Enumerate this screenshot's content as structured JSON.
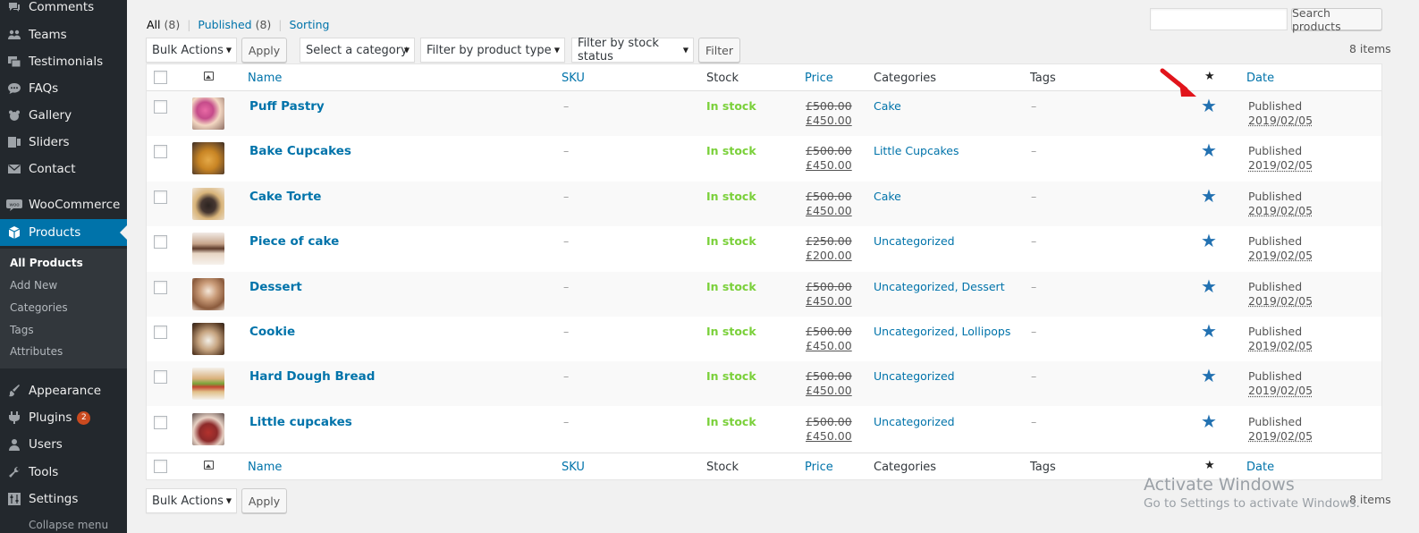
{
  "sidebar": {
    "items": [
      {
        "label": "Comments",
        "icon": "comments-icon"
      },
      {
        "label": "Teams",
        "icon": "teams-icon"
      },
      {
        "label": "Testimonials",
        "icon": "testimonials-icon"
      },
      {
        "label": "FAQs",
        "icon": "faq-icon"
      },
      {
        "label": "Gallery",
        "icon": "gallery-icon"
      },
      {
        "label": "Sliders",
        "icon": "sliders-icon"
      },
      {
        "label": "Contact",
        "icon": "mail-icon"
      },
      {
        "label": "WooCommerce",
        "icon": "woocommerce-icon"
      },
      {
        "label": "Products",
        "icon": "products-icon"
      },
      {
        "label": "Appearance",
        "icon": "appearance-icon"
      },
      {
        "label": "Plugins",
        "icon": "plugins-icon",
        "badge": "2"
      },
      {
        "label": "Users",
        "icon": "users-icon"
      },
      {
        "label": "Tools",
        "icon": "tools-icon"
      },
      {
        "label": "Settings",
        "icon": "settings-icon"
      }
    ],
    "submenu": [
      "All Products",
      "Add New",
      "Categories",
      "Tags",
      "Attributes"
    ],
    "collapse": "Collapse menu"
  },
  "views": {
    "all": "All",
    "all_count": "(8)",
    "published": "Published",
    "published_count": "(8)",
    "sorting": "Sorting",
    "sep": "|"
  },
  "search": {
    "value": "",
    "button": "Search products"
  },
  "toolbar": {
    "bulk_actions": "Bulk Actions",
    "apply": "Apply",
    "category": "Select a category",
    "product_type": "Filter by product type",
    "stock_status": "Filter by stock status",
    "filter": "Filter",
    "items": "8 items"
  },
  "columns": {
    "name": "Name",
    "sku": "SKU",
    "stock": "Stock",
    "price": "Price",
    "categories": "Categories",
    "tags": "Tags",
    "featured": "★",
    "date": "Date"
  },
  "products": [
    {
      "name": "Puff Pastry",
      "sku": "–",
      "stock": "In stock",
      "price_old": "£500.00",
      "price_new": "£450.00",
      "categories": "Cake",
      "tags": "–",
      "status": "Published",
      "date": "2019/02/05"
    },
    {
      "name": "Bake Cupcakes",
      "sku": "–",
      "stock": "In stock",
      "price_old": "£500.00",
      "price_new": "£450.00",
      "categories": "Little Cupcakes",
      "tags": "–",
      "status": "Published",
      "date": "2019/02/05"
    },
    {
      "name": "Cake Torte",
      "sku": "–",
      "stock": "In stock",
      "price_old": "£500.00",
      "price_new": "£450.00",
      "categories": "Cake",
      "tags": "–",
      "status": "Published",
      "date": "2019/02/05"
    },
    {
      "name": "Piece of cake",
      "sku": "–",
      "stock": "In stock",
      "price_old": "£250.00",
      "price_new": "£200.00",
      "categories": "Uncategorized",
      "tags": "–",
      "status": "Published",
      "date": "2019/02/05"
    },
    {
      "name": "Dessert",
      "sku": "–",
      "stock": "In stock",
      "price_old": "£500.00",
      "price_new": "£450.00",
      "categories": "Uncategorized, Dessert",
      "tags": "–",
      "status": "Published",
      "date": "2019/02/05"
    },
    {
      "name": "Cookie",
      "sku": "–",
      "stock": "In stock",
      "price_old": "£500.00",
      "price_new": "£450.00",
      "categories": "Uncategorized, Lollipops",
      "tags": "–",
      "status": "Published",
      "date": "2019/02/05"
    },
    {
      "name": "Hard Dough Bread",
      "sku": "–",
      "stock": "In stock",
      "price_old": "£500.00",
      "price_new": "£450.00",
      "categories": "Uncategorized",
      "tags": "–",
      "status": "Published",
      "date": "2019/02/05"
    },
    {
      "name": "Little cupcakes",
      "sku": "–",
      "stock": "In stock",
      "price_old": "£500.00",
      "price_new": "£450.00",
      "categories": "Uncategorized",
      "tags": "–",
      "status": "Published",
      "date": "2019/02/05"
    }
  ],
  "watermark": {
    "line1": "Activate Windows",
    "line2": "Go to Settings to activate Windows."
  },
  "colors": {
    "accent": "#0073aa",
    "instock": "#7ad03a",
    "sidebar": "#23282d",
    "star": "#2271b1",
    "arrow": "#e1141b"
  }
}
